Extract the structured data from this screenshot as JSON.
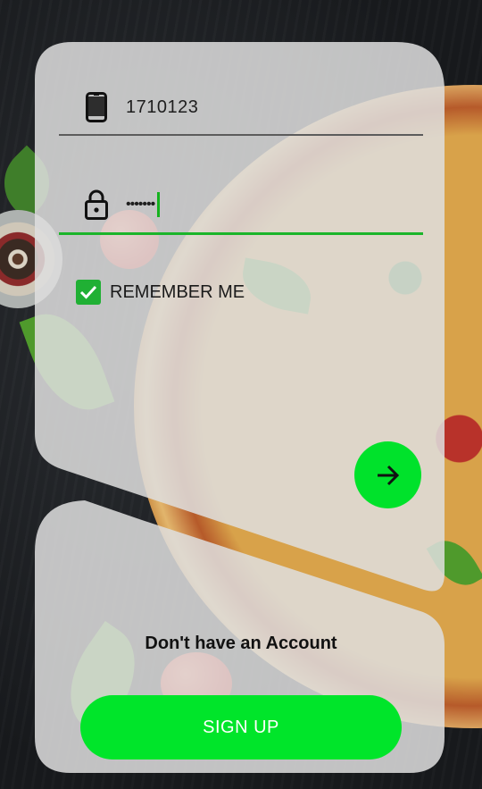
{
  "form": {
    "phone_value": "1710123",
    "password_value": "•••••••",
    "remember_label": "REMEMBER ME",
    "remember_checked": true
  },
  "signup": {
    "prompt": "Don't have an Account",
    "button_label": "SIGN UP"
  },
  "colors": {
    "accent_green": "#00e22b",
    "active_underline": "#1bb52a",
    "card_background": "rgba(222,222,222,0.86)"
  },
  "icons": {
    "phone": "smartphone-icon",
    "password": "lock-icon",
    "checkbox": "checkmark-icon",
    "submit": "arrow-right-icon"
  }
}
